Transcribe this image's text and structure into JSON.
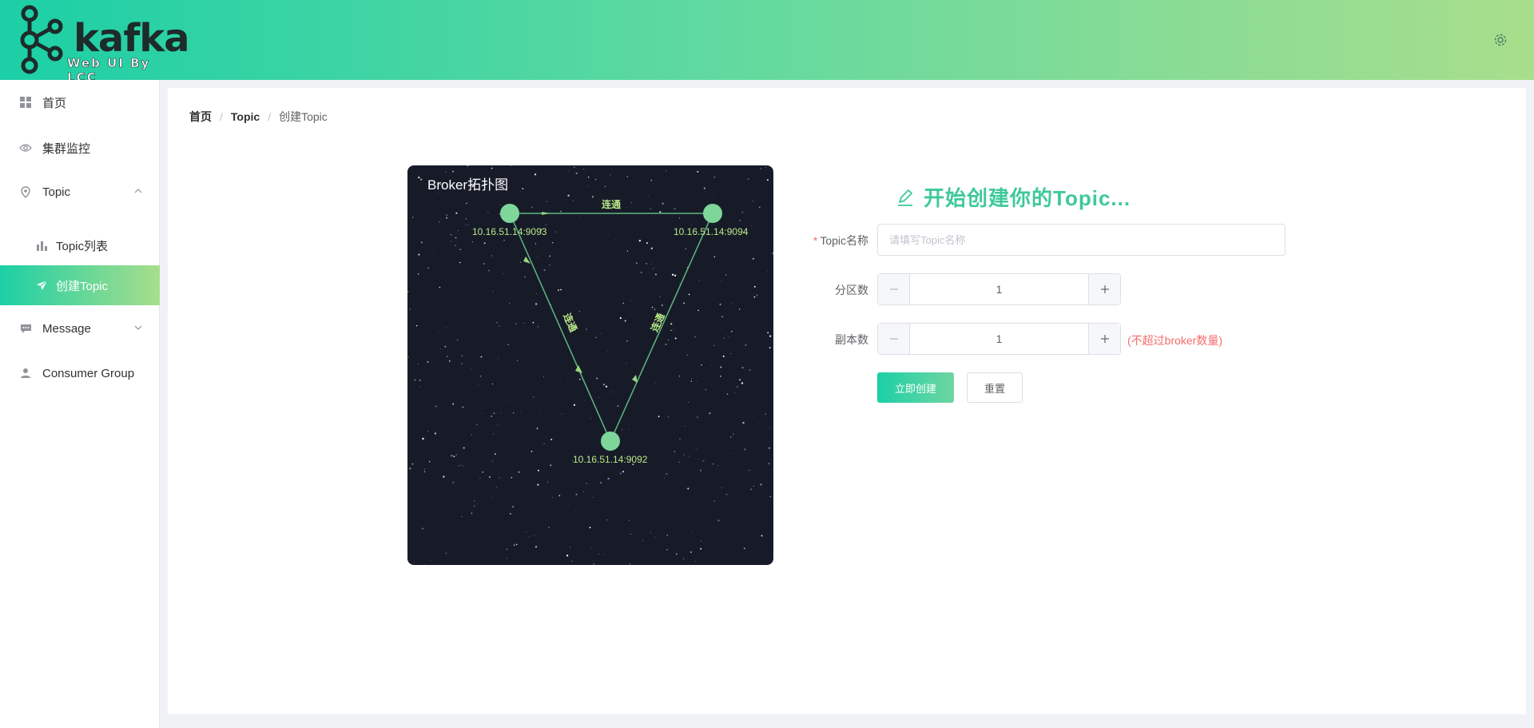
{
  "header": {
    "logo_text": "kafka",
    "logo_subtitle": "Web UI By LCC",
    "settings_icon": "gear-icon"
  },
  "sidebar": {
    "items": [
      {
        "label": "首页",
        "icon": "grid-icon"
      },
      {
        "label": "集群监控",
        "icon": "eye-icon"
      },
      {
        "label": "Topic",
        "icon": "location-pin-icon",
        "expanded": true
      },
      {
        "label": "Topic列表",
        "icon": "bar-chart-icon"
      },
      {
        "label": "创建Topic",
        "icon": "send-icon",
        "active": true
      },
      {
        "label": "Message",
        "icon": "chat-icon",
        "expanded": false
      },
      {
        "label": "Consumer Group",
        "icon": "user-icon"
      }
    ]
  },
  "breadcrumb": [
    "首页",
    "Topic",
    "创建Topic"
  ],
  "topology": {
    "title": "Broker拓扑图",
    "nodes": [
      "10.16.51.14:9093",
      "10.16.51.14:9094",
      "10.16.51.14:9092"
    ],
    "edge_label": "连通"
  },
  "form": {
    "title": "开始创建你的Topic...",
    "topic_name_label": "Topic名称",
    "topic_name_placeholder": "请填写Topic名称",
    "partitions_label": "分区数",
    "partitions_value": "1",
    "replicas_label": "副本数",
    "replicas_value": "1",
    "replicas_hint": "(不超过broker数量)",
    "submit_label": "立即创建",
    "reset_label": "重置"
  },
  "colors": {
    "accent": "#1ccfa6",
    "accent_end": "#a8de8c",
    "danger": "#f56c6c"
  }
}
